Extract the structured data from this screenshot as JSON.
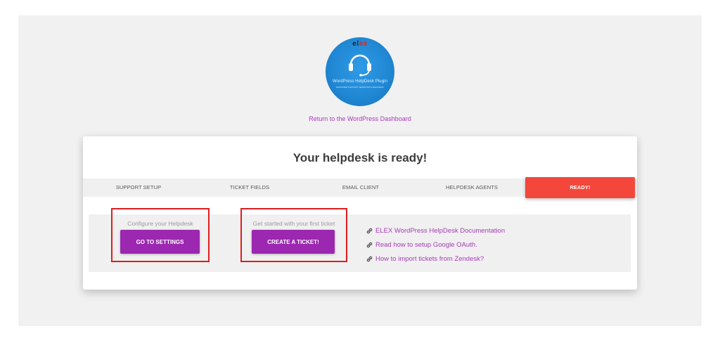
{
  "logo": {
    "brand_prefix": "el",
    "brand_x": "ex",
    "plugin_name": "WordPress HelpDesk Plugin",
    "tagline": "EMPOWER SUPPORT TEAMS WITH HELPDESK"
  },
  "header": {
    "dashboard_link": "Return to the WordPress Dashboard"
  },
  "card": {
    "title": "Your helpdesk is ready!"
  },
  "steps": [
    {
      "label": "SUPPORT SETUP"
    },
    {
      "label": "TICKET FIELDS"
    },
    {
      "label": "EMAIL CLIENT"
    },
    {
      "label": "HELPDESK AGENTS"
    },
    {
      "label": "READY!",
      "active": true
    }
  ],
  "actions": {
    "settings_hint": "Configure your Helpdesk",
    "settings_button": "GO TO SETTINGS",
    "ticket_hint": "Get started with your first ticket",
    "ticket_button": "CREATE A TICKET!"
  },
  "links": [
    {
      "label": "ELEX WordPress HelpDesk Documentation",
      "icon": "link-icon"
    },
    {
      "label": "Read how to setup Google OAuth.",
      "icon": "link-icon"
    },
    {
      "label": "How to import tickets from Zendesk?",
      "icon": "link-icon"
    }
  ],
  "colors": {
    "accent": "#9c27b0",
    "link": "#a63bb6",
    "ready": "#f2473a",
    "highlight": "#e01d1d"
  }
}
